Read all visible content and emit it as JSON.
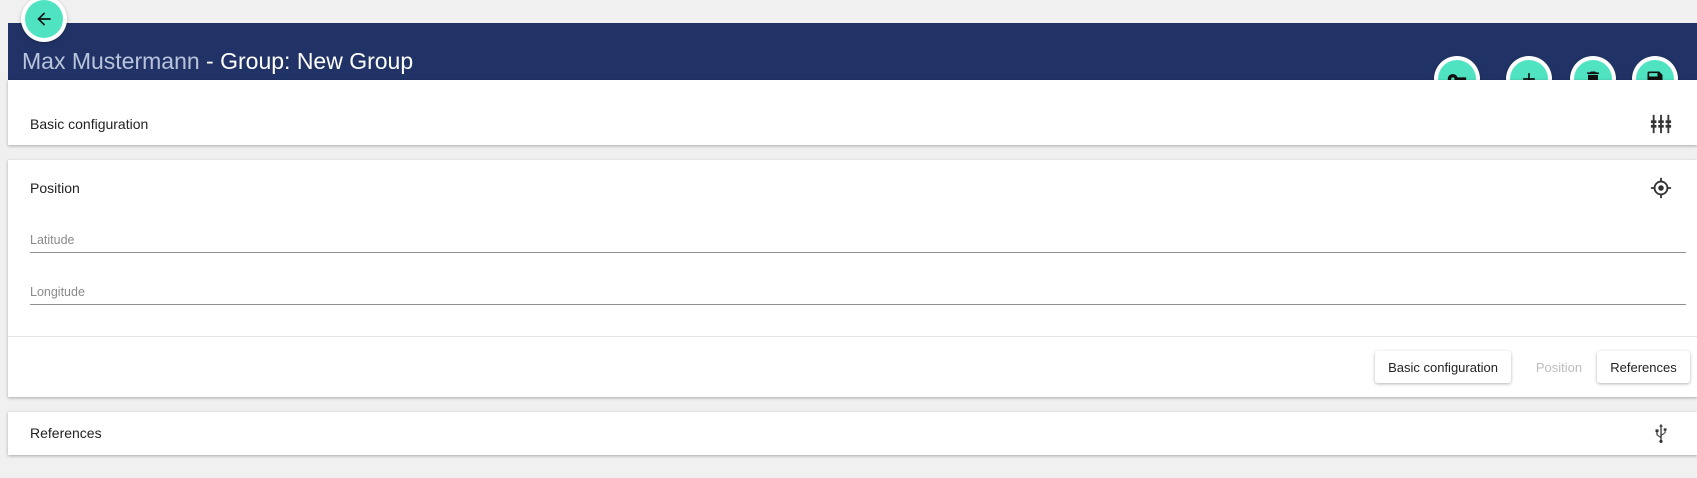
{
  "header": {
    "user_name": "Max Mustermann",
    "title_rest": " - Group: New Group",
    "bar_color": "#213366"
  },
  "fabs": {
    "back": "arrow-left-icon",
    "key": "key-icon",
    "add": "plus-icon",
    "delete": "trash-icon",
    "save": "save-icon",
    "accent": "#4fe3c1"
  },
  "sections": {
    "basic": {
      "title": "Basic configuration",
      "icon": "tune-icon"
    },
    "position": {
      "title": "Position",
      "icon": "crosshairs-gps-icon",
      "latitude_placeholder": "Latitude",
      "longitude_placeholder": "Longitude",
      "nav_basic": "Basic configuration",
      "nav_position": "Position",
      "nav_references": "References"
    },
    "references": {
      "title": "References",
      "icon": "usb-icon"
    }
  }
}
